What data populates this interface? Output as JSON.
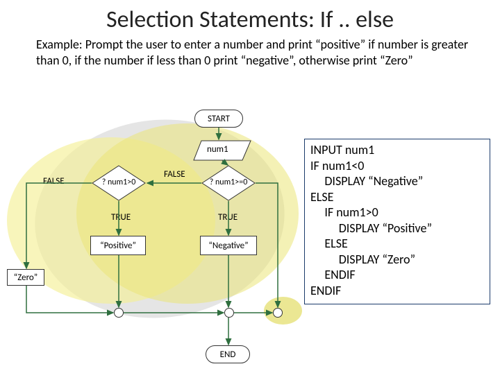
{
  "title": "Selection Statements: If .. else",
  "example": "Example: Prompt the user to enter a number and print “positive” if number is greater than 0, if the number if less than 0 print “negative”, otherwise print “Zero”",
  "flow": {
    "start": "START",
    "input": "num1",
    "decision1": "? num1>0",
    "decision2": "?\nnum1>=0",
    "true": "TRUE",
    "false": "FALSE",
    "out_positive": "“Positive”",
    "out_negative": "“Negative”",
    "out_zero": "“Zero”",
    "end": "END"
  },
  "pseudocode": "INPUT num1\nIF num1<0\n     DISPLAY “Negative”\nELSE\n     IF num1>0\n          DISPLAY “Positive”\n     ELSE\n          DISPLAY “Zero”\n     ENDIF\nENDIF"
}
